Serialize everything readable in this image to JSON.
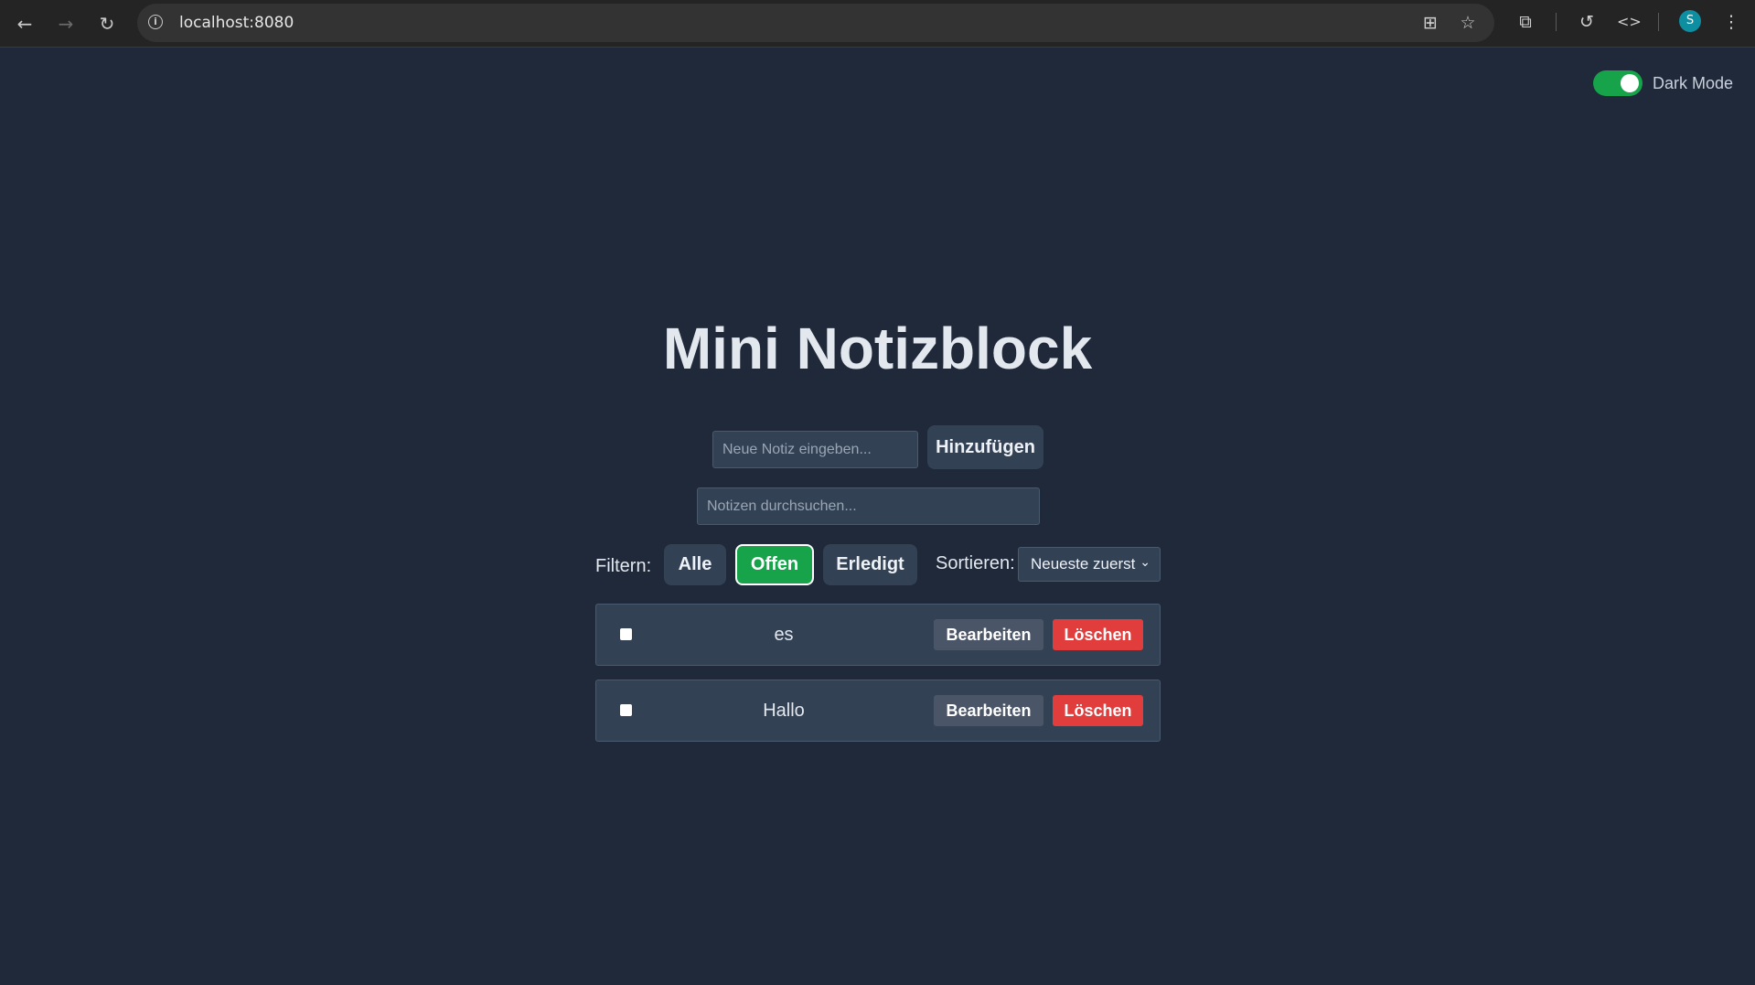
{
  "browser": {
    "url": "localhost:8080",
    "back_icon": "←",
    "forward_icon": "→",
    "reload_icon": "↻",
    "info_icon": "i",
    "translate_icon": "⊞",
    "star_icon": "☆",
    "extensions_icon": "⧉",
    "history_icon": "↺",
    "devtools_icon": "<>",
    "profile_initial": "S",
    "menu_icon": "⋮"
  },
  "dark_mode": {
    "label": "Dark Mode",
    "enabled": true,
    "accent": "#16a34a"
  },
  "app": {
    "title": "Mini Notizblock",
    "new_note": {
      "placeholder": "Neue Notiz eingeben...",
      "value": ""
    },
    "add_button": "Hinzufügen",
    "search": {
      "placeholder": "Notizen durchsuchen...",
      "value": ""
    },
    "filter_label": "Filtern:",
    "filters": [
      {
        "label": "Alle",
        "active": false
      },
      {
        "label": "Offen",
        "active": true
      },
      {
        "label": "Erledigt",
        "active": false
      }
    ],
    "sort_label": "Sortieren:",
    "sort_selected": "Neueste zuerst",
    "notes": [
      {
        "text": "es",
        "done": false
      },
      {
        "text": "Hallo",
        "done": false
      }
    ],
    "edit_label": "Bearbeiten",
    "delete_label": "Löschen"
  },
  "colors": {
    "background": "#1f293a",
    "surface": "#324154",
    "active_filter": "#16a34a",
    "delete": "#e23d3d",
    "edit": "#4a5567"
  }
}
